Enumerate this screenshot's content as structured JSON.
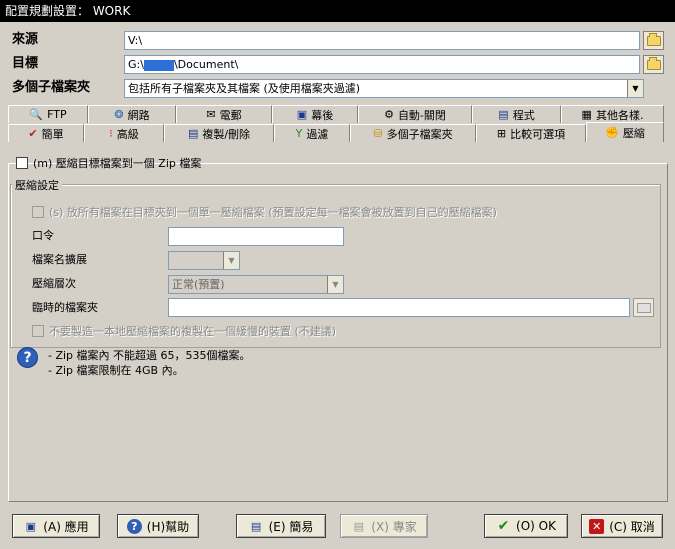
{
  "window": {
    "title": "配置規劃設置： WORK"
  },
  "source": {
    "label": "來源",
    "value": "V:\\"
  },
  "target": {
    "label": "目標",
    "value_prefix": "G:\\",
    "value_suffix": "\\Document\\"
  },
  "subfolders": {
    "label": "多個子檔案夾",
    "value": "包括所有子檔案夾及其檔案 (及使用檔案夾過濾)"
  },
  "tabs_row1": [
    {
      "label": "FTP",
      "icon": "ftp-icon"
    },
    {
      "label": "網路",
      "icon": "network-icon"
    },
    {
      "label": "電郵",
      "icon": "email-icon"
    },
    {
      "label": "幕後",
      "icon": "background-icon"
    },
    {
      "label": "自動-關閉",
      "icon": "auto-close-icon"
    },
    {
      "label": "程式",
      "icon": "program-icon"
    },
    {
      "label": "其他各樣.",
      "icon": "misc-icon"
    }
  ],
  "tabs_row2": [
    {
      "label": "簡單",
      "icon": "simple-icon"
    },
    {
      "label": "高級",
      "icon": "advanced-icon"
    },
    {
      "label": "複製/刪除",
      "icon": "copy-delete-icon"
    },
    {
      "label": "過濾",
      "icon": "filter-icon"
    },
    {
      "label": "多個子檔案夾",
      "icon": "subfolders-icon"
    },
    {
      "label": "比較可選項",
      "icon": "compare-icon"
    },
    {
      "label": "壓縮",
      "icon": "compress-icon",
      "active": true
    }
  ],
  "compress": {
    "zip_checkbox": "(m) 壓縮目標檔案到一個 Zip 檔案",
    "group_title": "壓縮設定",
    "single_archive": "(s) 放所有檔案在目標夾到一個單一壓縮檔案 (預置設定每一檔案會被放置到自己的壓縮檔案)",
    "password_label": "口令",
    "ext_label": "檔案名擴展",
    "level_label": "壓縮層次",
    "level_value": "正常(預置)",
    "temp_label": "臨時的檔案夾",
    "no_local_copy": "不要製造一本地壓縮檔案的複製在一個緩慢的裝置 (不建議)",
    "note1": "- Zip 檔案內 不能超過 65，535個檔案。",
    "note2": "- Zip 檔案限制在 4GB 內。"
  },
  "buttons": {
    "apply": "(A) 應用",
    "help": "(H)幫助",
    "simple": "(E) 簡易",
    "expert": "(X) 專家",
    "ok": "(O) OK",
    "cancel": "(C) 取消"
  }
}
